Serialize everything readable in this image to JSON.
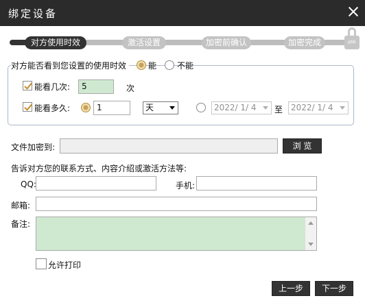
{
  "window": {
    "title": "绑定设备"
  },
  "steps": [
    {
      "label": "对方使用时效",
      "active": true
    },
    {
      "label": "激活设置",
      "active": false
    },
    {
      "label": "加密前确认",
      "active": false
    },
    {
      "label": "加密完成",
      "active": false
    }
  ],
  "lock_badge": "pbb",
  "visibility": {
    "legend": "对方能否看到您设置的使用时效",
    "option_yes": "能",
    "option_no": "不能",
    "times": {
      "label": "能看几次:",
      "value": "5",
      "unit": "次"
    },
    "duration": {
      "label": "能看多久:",
      "value": "1",
      "unit_selected": "天",
      "date_from": "2022/ 1/ 4",
      "to_label": "至",
      "date_to": "2022/ 1/ 4"
    }
  },
  "encrypt_to": {
    "label": "文件加密到:",
    "value": "",
    "browse": "浏 览"
  },
  "contact": {
    "heading": "告诉对方您的联系方式、内容介绍或激活方法等:",
    "qq_label": "QQ:",
    "phone_label": "手机:",
    "email_label": "邮箱:",
    "note_label": "备注:"
  },
  "allow_print": {
    "label": "允许打印",
    "checked": false
  },
  "footer": {
    "prev": "上一步",
    "next": "下一步"
  }
}
